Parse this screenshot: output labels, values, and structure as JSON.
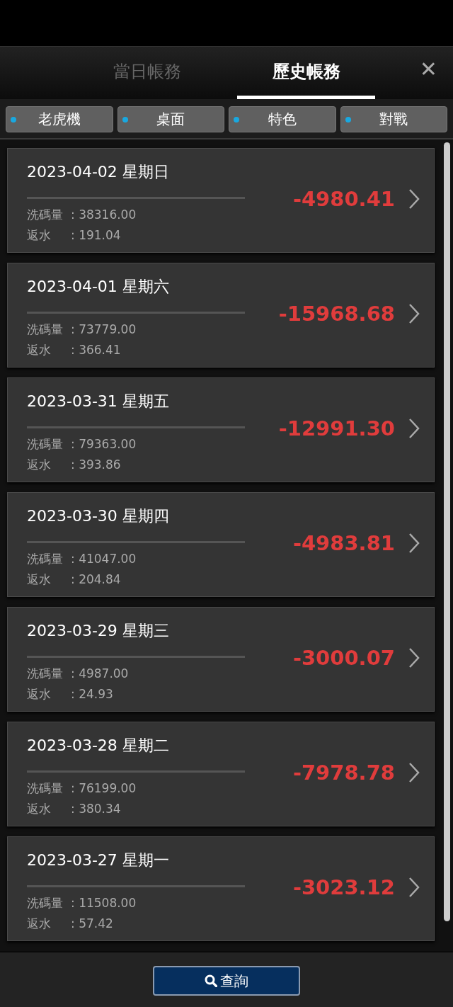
{
  "tabs": [
    {
      "label": "當日帳務",
      "selected": false
    },
    {
      "label": "歷史帳務",
      "selected": true
    }
  ],
  "close": "✕",
  "filters": [
    {
      "label": "老虎機",
      "on": true
    },
    {
      "label": "桌面",
      "on": true
    },
    {
      "label": "特色",
      "on": true
    },
    {
      "label": "對戰",
      "on": true
    }
  ],
  "records": [
    {
      "date": "2023-04-02 星期日",
      "stats": [
        {
          "label": "洗碼量",
          "value": ": 38316.00"
        },
        {
          "label": "返水",
          "value": ": 191.04"
        }
      ],
      "amount": "-4980.41"
    },
    {
      "date": "2023-04-01 星期六",
      "stats": [
        {
          "label": "洗碼量",
          "value": ": 73779.00"
        },
        {
          "label": "返水",
          "value": ": 366.41"
        }
      ],
      "amount": "-15968.68"
    },
    {
      "date": "2023-03-31 星期五",
      "stats": [
        {
          "label": "洗碼量",
          "value": ": 79363.00"
        },
        {
          "label": "返水",
          "value": ": 393.86"
        }
      ],
      "amount": "-12991.30"
    },
    {
      "date": "2023-03-30 星期四",
      "stats": [
        {
          "label": "洗碼量",
          "value": ": 41047.00"
        },
        {
          "label": "返水",
          "value": ": 204.84"
        }
      ],
      "amount": "-4983.81"
    },
    {
      "date": "2023-03-29 星期三",
      "stats": [
        {
          "label": "洗碼量",
          "value": ": 4987.00"
        },
        {
          "label": "返水",
          "value": ": 24.93"
        }
      ],
      "amount": "-3000.07"
    },
    {
      "date": "2023-03-28 星期二",
      "stats": [
        {
          "label": "洗碼量",
          "value": ": 76199.00"
        },
        {
          "label": "返水",
          "value": ": 380.34"
        }
      ],
      "amount": "-7978.78"
    },
    {
      "date": "2023-03-27 星期一",
      "stats": [
        {
          "label": "洗碼量",
          "value": ": 11508.00"
        },
        {
          "label": "返水",
          "value": ": 57.42"
        }
      ],
      "amount": "-3023.12"
    }
  ],
  "query_button": "查詢"
}
